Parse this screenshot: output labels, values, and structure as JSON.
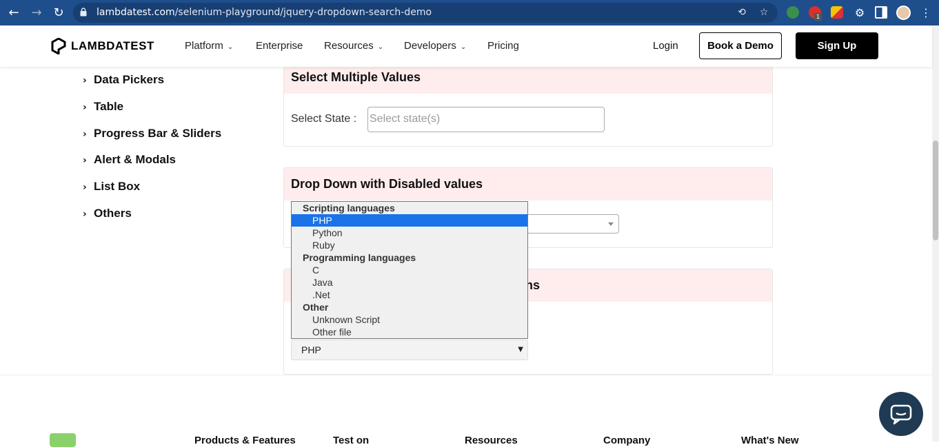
{
  "browser": {
    "url_domain": "lambdatest.com",
    "url_path": "/selenium-playground/jquery-dropdown-search-demo",
    "back_icon": "arrow-left-icon",
    "forward_icon": "arrow-right-icon",
    "reload_icon": "reload-icon",
    "abp_badge": "1"
  },
  "header": {
    "logo_text": "LAMBDATEST",
    "nav": [
      {
        "label": "Platform",
        "has_dropdown": true
      },
      {
        "label": "Enterprise",
        "has_dropdown": false
      },
      {
        "label": "Resources",
        "has_dropdown": true
      },
      {
        "label": "Developers",
        "has_dropdown": true
      },
      {
        "label": "Pricing",
        "has_dropdown": false
      }
    ],
    "login": "Login",
    "book_demo": "Book a Demo",
    "sign_up": "Sign Up"
  },
  "sidebar": {
    "items": [
      "Data Pickers",
      "Table",
      "Progress Bar & Sliders",
      "Alert & Modals",
      "List Box",
      "Others"
    ]
  },
  "section_multi": {
    "title": "Select Multiple Values",
    "label": "Select State :",
    "placeholder": "Select state(s)"
  },
  "section_disabled": {
    "title": "Drop Down with Disabled values"
  },
  "section_category": {
    "title_visible_tail": "ns",
    "selected": "PHP"
  },
  "popup": {
    "rows": [
      {
        "label": "Scripting languages",
        "group": true,
        "selected": false
      },
      {
        "label": "PHP",
        "group": false,
        "selected": true
      },
      {
        "label": "Python",
        "group": false,
        "selected": false
      },
      {
        "label": "Ruby",
        "group": false,
        "selected": false
      },
      {
        "label": "Programming languages",
        "group": true,
        "selected": false
      },
      {
        "label": "C",
        "group": false,
        "selected": false
      },
      {
        "label": "Java",
        "group": false,
        "selected": false
      },
      {
        "label": ".Net",
        "group": false,
        "selected": false
      },
      {
        "label": "Other",
        "group": true,
        "selected": false
      },
      {
        "label": "Unknown Script",
        "group": false,
        "selected": false
      },
      {
        "label": "Other file",
        "group": false,
        "selected": false
      }
    ]
  },
  "footer": {
    "columns": [
      "Products & Features",
      "Test on",
      "Resources",
      "Company",
      "What's New"
    ]
  },
  "colors": {
    "chrome": "#1f4e8c",
    "card_header": "#ffeded",
    "selected_option": "#1a73e8",
    "chat": "#1f3a52"
  }
}
